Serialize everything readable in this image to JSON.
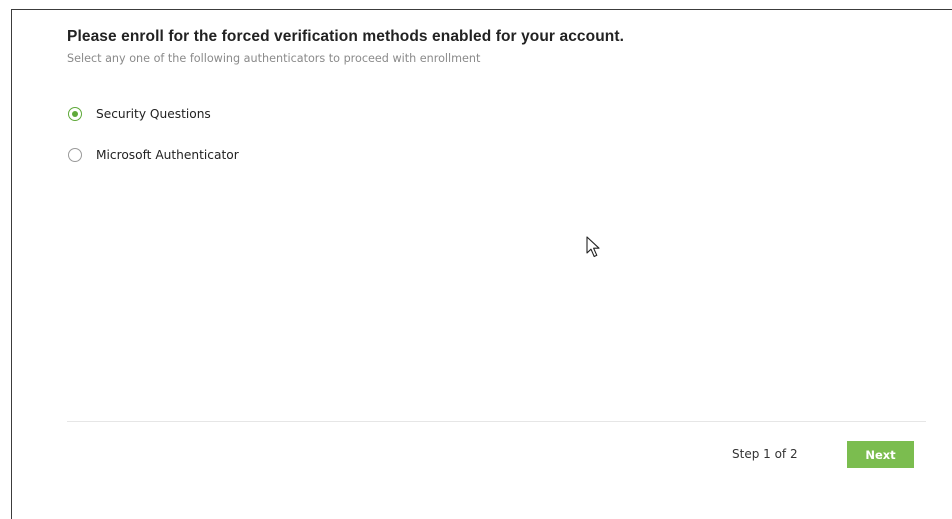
{
  "enrollment": {
    "title": "Please enroll for the forced verification methods enabled for your account.",
    "subtitle": "Select any one of the following authenticators to proceed with enrollment",
    "options": [
      {
        "label": "Security Questions",
        "selected": true
      },
      {
        "label": "Microsoft Authenticator",
        "selected": false
      }
    ]
  },
  "footer": {
    "step_text": "Step 1 of 2",
    "next_label": "Next"
  },
  "colors": {
    "accent": "#7bbd4f",
    "radio_selected": "#5fa93a",
    "subtitle_text": "#8a8a8a"
  },
  "icons": {
    "cursor": "mouse-pointer-icon"
  }
}
